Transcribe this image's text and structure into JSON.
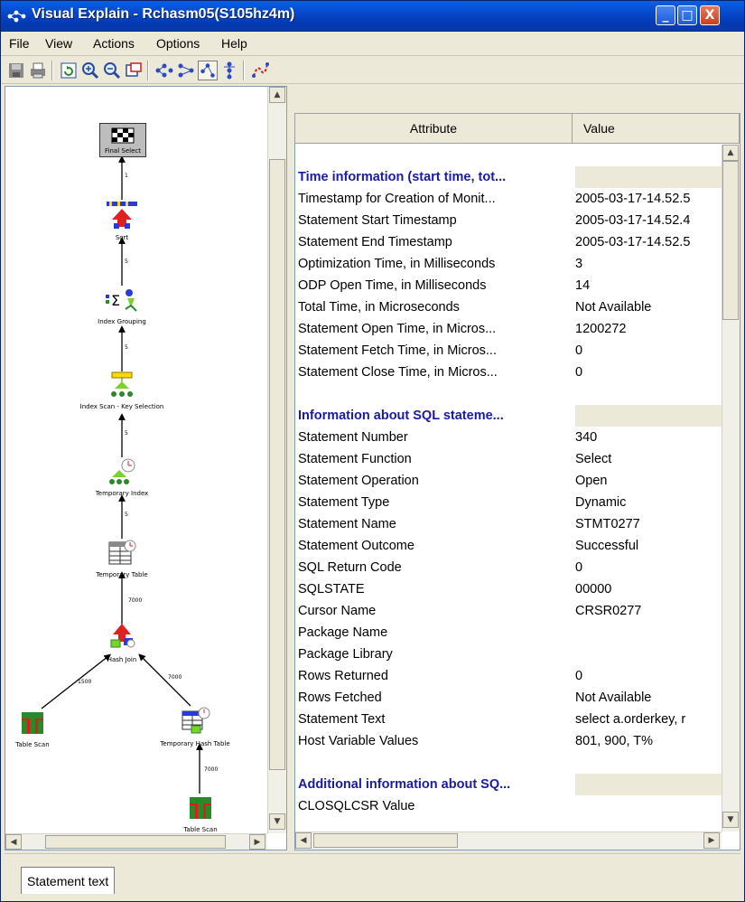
{
  "window": {
    "title": "Visual Explain - Rchasm05(S105hz4m)",
    "app_icon": "visual-explain-icon",
    "controls": {
      "minimize": "_",
      "maximize": "□",
      "close": "X"
    }
  },
  "menu": [
    "File",
    "View",
    "Actions",
    "Options",
    "Help"
  ],
  "toolbar": [
    "save-icon",
    "print-icon",
    "refresh-icon",
    "zoom-in-icon",
    "zoom-out-icon",
    "fit-window-icon",
    "graph-vertical-icon",
    "graph-horizontal-icon",
    "graph-tree-icon",
    "graph-dependency-icon",
    "highlight-icon"
  ],
  "graph": {
    "nodes": [
      {
        "id": "final-select",
        "label": "Final Select"
      },
      {
        "id": "sort",
        "label": "Sort"
      },
      {
        "id": "index-grouping",
        "label": "Index Grouping"
      },
      {
        "id": "index-scan",
        "label": "Index Scan - Key Selection"
      },
      {
        "id": "temporary-index",
        "label": "Temporary Index"
      },
      {
        "id": "temporary-table",
        "label": "Temporary Table"
      },
      {
        "id": "hash-join",
        "label": "Hash Join"
      },
      {
        "id": "table-scan-1",
        "label": "Table Scan"
      },
      {
        "id": "temporary-hash-table",
        "label": "Temporary Hash Table"
      },
      {
        "id": "table-scan-2",
        "label": "Table Scan"
      }
    ]
  },
  "table": {
    "headers": {
      "attribute": "Attribute",
      "value": "Value"
    },
    "sections": [
      {
        "title": "Time information (start time, tot...",
        "rows": [
          {
            "attr": "Timestamp for Creation of Monit...",
            "value": "2005-03-17-14.52.5"
          },
          {
            "attr": "Statement Start Timestamp",
            "value": "2005-03-17-14.52.4"
          },
          {
            "attr": "Statement End Timestamp",
            "value": "2005-03-17-14.52.5"
          },
          {
            "attr": "Optimization Time, in Milliseconds",
            "value": "3"
          },
          {
            "attr": "ODP Open Time, in Milliseconds",
            "value": "14"
          },
          {
            "attr": "Total Time, in Microseconds",
            "value": "Not Available"
          },
          {
            "attr": "Statement Open Time, in Micros...",
            "value": "1200272"
          },
          {
            "attr": "Statement Fetch Time, in Micros...",
            "value": "0"
          },
          {
            "attr": "Statement Close Time, in Micros...",
            "value": "0"
          }
        ]
      },
      {
        "title": "Information about SQL stateme...",
        "rows": [
          {
            "attr": "Statement Number",
            "value": "340"
          },
          {
            "attr": "Statement Function",
            "value": "Select"
          },
          {
            "attr": "Statement Operation",
            "value": "Open"
          },
          {
            "attr": "Statement Type",
            "value": "Dynamic"
          },
          {
            "attr": "Statement Name",
            "value": "STMT0277"
          },
          {
            "attr": "Statement Outcome",
            "value": "Successful"
          },
          {
            "attr": "SQL Return Code",
            "value": "0"
          },
          {
            "attr": "SQLSTATE",
            "value": "00000"
          },
          {
            "attr": "Cursor Name",
            "value": "CRSR0277"
          },
          {
            "attr": "Package Name",
            "value": ""
          },
          {
            "attr": "Package Library",
            "value": ""
          },
          {
            "attr": "Rows Returned",
            "value": "0"
          },
          {
            "attr": "Rows Fetched",
            "value": "Not Available"
          },
          {
            "attr": "Statement Text",
            "value": "select  a.orderkey, r"
          },
          {
            "attr": "Host Variable Values",
            "value": "801, 900, T%"
          }
        ]
      },
      {
        "title": "Additional information about SQ...",
        "rows": [
          {
            "attr": "CLOSQLCSR Value",
            "value": ""
          }
        ]
      }
    ]
  },
  "bottom_tab": "Statement text"
}
